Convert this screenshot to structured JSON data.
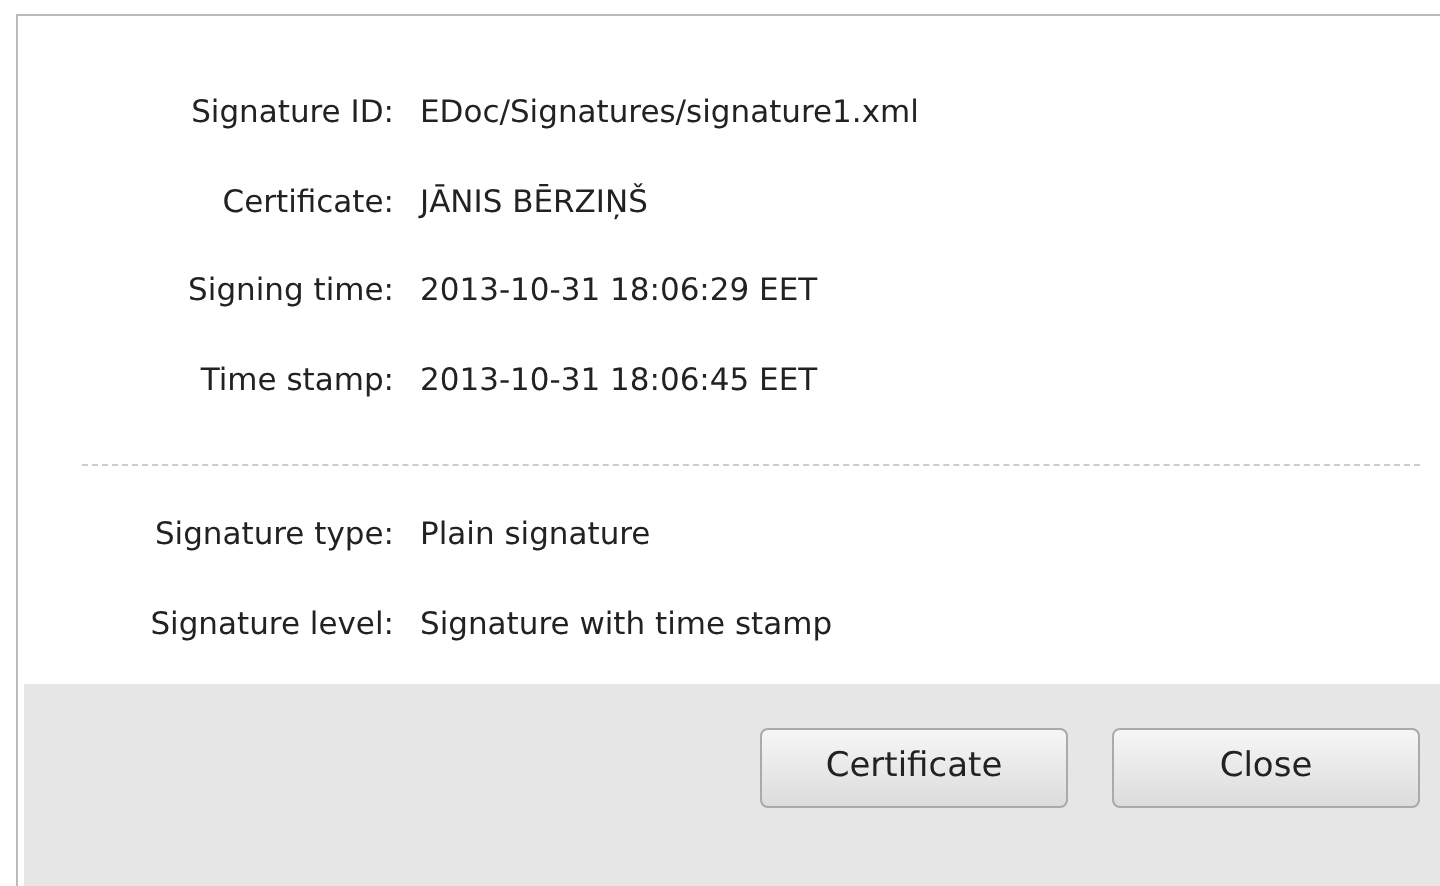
{
  "details": [
    {
      "label": "Signature ID:",
      "value": "EDoc/Signatures/signature1.xml"
    },
    {
      "label": "Certificate:",
      "value": "JĀNIS BĒRZIŅŠ"
    },
    {
      "label": "Signing time:",
      "value": "2013-10-31 18:06:29 EET"
    },
    {
      "label": "Time stamp:",
      "value": "2013-10-31 18:06:45 EET"
    }
  ],
  "summary": [
    {
      "label": "Signature type:",
      "value": "Plain signature"
    },
    {
      "label": "Signature level:",
      "value": "Signature with time stamp"
    }
  ],
  "buttons": [
    "Certificate",
    "Close"
  ]
}
